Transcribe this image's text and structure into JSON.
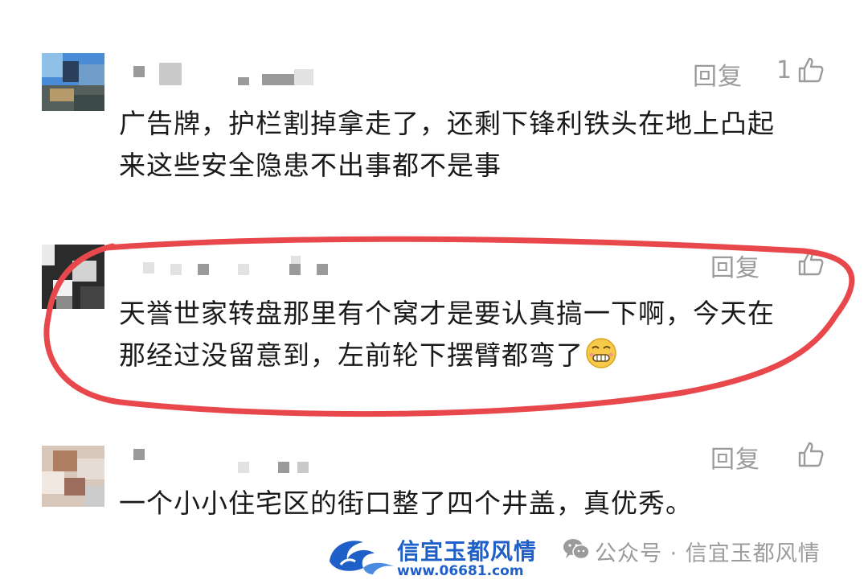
{
  "comments": [
    {
      "reply_label": "回复",
      "like_count": "1",
      "text_line1": "广告牌，护栏割掉拿走了，还剩下锋利铁头在地上凸起",
      "text_line2": "来这些安全隐患不出事都不是事"
    },
    {
      "reply_label": "回复",
      "like_count": "",
      "text_line1": "天誉世家转盘那里有个窝才是要认真搞一下啊，今天在",
      "text_line2": "那经过没留意到，左前轮下摆臂都弯了",
      "emoji": "grimace-emoji",
      "highlighted": true,
      "highlight_color": "#e8474b"
    },
    {
      "reply_label": "回复",
      "like_count": "",
      "text_line1": "一个小小住宅区的街口整了四个井盖，真优秀。"
    }
  ],
  "footer": {
    "watermark_title": "信宜玉都风情",
    "watermark_url": "www.06681.com",
    "account_label": "公众号 · 信宜玉都风情",
    "account_icon": "wechat-icon",
    "brand_color": "#1f5fc8"
  },
  "colors": {
    "text": "#1a1a1a",
    "muted": "#9b9b9b",
    "annotation": "#e8474b"
  }
}
